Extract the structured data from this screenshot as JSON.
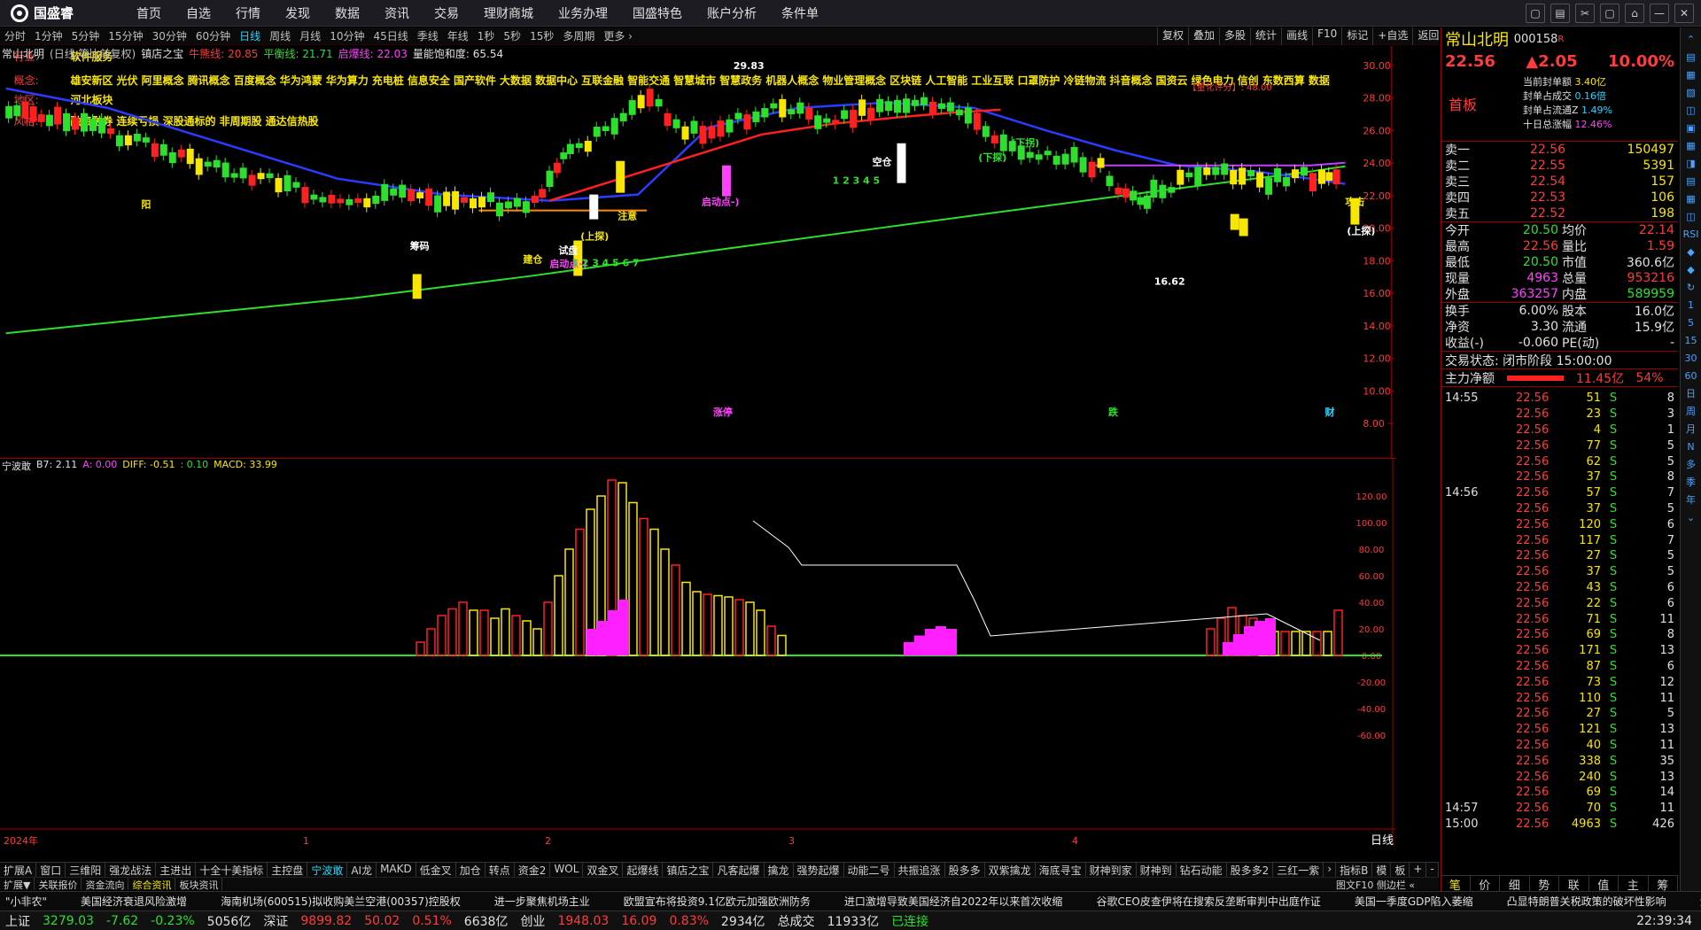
{
  "app": {
    "logo_text": "国盛睿"
  },
  "menu": [
    "首页",
    "自选",
    "行情",
    "发现",
    "数据",
    "资讯",
    "交易",
    "理财商城",
    "业务办理",
    "国盛特色",
    "账户分析",
    "条件单"
  ],
  "window_buttons": [
    "▢",
    "▤",
    "✂",
    "▢",
    "⌂",
    "—",
    "✕"
  ],
  "periods": [
    "分时",
    "1分钟",
    "5分钟",
    "15分钟",
    "30分钟",
    "60分钟",
    "日线",
    "周线",
    "月线",
    "10分钟",
    "45日线",
    "季线",
    "年线",
    "1秒",
    "5秒",
    "15秒",
    "多周期",
    "更多 ›"
  ],
  "active_period": "日线",
  "tools": [
    "复权",
    "叠加",
    "多股",
    "统计",
    "画线",
    "F10",
    "标记",
    "+自选",
    "返回"
  ],
  "info": {
    "name": "常山北明",
    "mode": "(日线,等比前复权)",
    "indicator": "镇店之宝",
    "niu": "牛熊线: 20.85",
    "ping": "平衡线: 21.71",
    "qi": "启爆线: 22.03",
    "zhan": "量能饱和度: 65.54"
  },
  "labels": {
    "hangye_k": "行业:",
    "hangye_v": "软件服务",
    "gainian_k": "概念:",
    "gainian_v": "雄安新区 光伏 阿里概念 腾讯概念 百度概念 华为鸿蒙 华为算力 充电桩 信息安全 国产软件 大数据 数据中心 互联金融 智能交通 智慧城市 智慧政务 机器人概念 物业管理概念 区块链 人工智能 工业互联 口罩防护 冷链物流 抖音概念 国资云 绿色电力 信创 东数西算 数据",
    "diqu_k": "地区:",
    "diqu_v": "河北板块",
    "fengge_k": "风格:",
    "fengge_v": "融资融券 连续亏损 深股通标的 非周期股 通达信热股",
    "score": "【量化评分】: 48.00"
  },
  "price_axis": [
    "30.00",
    "28.00",
    "26.00",
    "24.00",
    "22.00",
    "20.00",
    "18.00",
    "16.00",
    "14.00",
    "12.00",
    "10.00",
    "8.00"
  ],
  "annotations": {
    "hi": "29.83",
    "lo": "16.62",
    "a1": "启动点-)",
    "a2": "启动点-)",
    "a3": "(上探)",
    "a4": "(下探)",
    "a5": "(上探)",
    "a6": "试盘",
    "a7": "建仓",
    "a8": "攻击",
    "a9": "空仓",
    "a10": "(下拐)",
    "a11": "筹码",
    "a12": "涨停",
    "a13": "跌",
    "a14": "财",
    "a15": "阳",
    "a16": "注意",
    "a17": "1 2 3 4 5 6 7",
    "a18": "1 2 3 4 5"
  },
  "sub_info": {
    "name": "宁波敢",
    "b7": "B7: 2.11",
    "a": "A: 0.00",
    "diff": "DIFF: -0.51",
    "dea": ": 0.10",
    "macd": "MACD: 33.99"
  },
  "sub_axis": [
    "120.00",
    "100.00",
    "80.00",
    "60.00",
    "40.00",
    "20.00",
    "0.00",
    "-20.00",
    "-40.00",
    "-60.00"
  ],
  "date_labels": [
    "2024年",
    "1",
    "2",
    "3",
    "4"
  ],
  "date_right": "日线",
  "quote": {
    "name": "常山北明",
    "code": "000158",
    "flag": "R",
    "price": "22.56",
    "change": "▲2.05",
    "pct": "10.00%",
    "board": "首板",
    "seal": [
      [
        "当前封单额",
        "3.40亿"
      ],
      [
        "封单占成交",
        "0.16倍"
      ],
      [
        "封单占流通Z",
        "1.49%"
      ],
      [
        "十日总涨幅",
        "12.46%"
      ]
    ],
    "asks": [
      [
        "卖一",
        "22.56",
        "150497"
      ],
      [
        "卖二",
        "22.55",
        "5391"
      ],
      [
        "卖三",
        "22.54",
        "157"
      ],
      [
        "卖四",
        "22.53",
        "106"
      ],
      [
        "卖五",
        "22.52",
        "198"
      ]
    ],
    "stats": [
      [
        "今开",
        "20.50",
        "均价",
        "22.14"
      ],
      [
        "最高",
        "22.56",
        "量比",
        "1.59"
      ],
      [
        "最低",
        "20.50",
        "市值",
        "360.6亿"
      ],
      [
        "现量",
        "4963",
        "总量",
        "953216"
      ],
      [
        "外盘",
        "363257",
        "内盘",
        "589959"
      ]
    ],
    "stats2": [
      [
        "换手",
        "6.00%",
        "股本",
        "16.0亿"
      ],
      [
        "净资",
        "3.30",
        "流通",
        "15.9亿"
      ],
      [
        "收益(-)",
        "-0.060",
        "PE(动)",
        "-"
      ]
    ],
    "trade_state": "交易状态: 闭市阶段 15:00:00",
    "main_flow_label": "主力净额",
    "main_flow": "11.45亿",
    "main_flow_pct": "54%"
  },
  "ticks": [
    [
      "14:55",
      "22.56",
      "51",
      "S",
      "8"
    ],
    [
      "",
      "22.56",
      "23",
      "S",
      "3"
    ],
    [
      "",
      "22.56",
      "4",
      "S",
      "1"
    ],
    [
      "",
      "22.56",
      "77",
      "S",
      "5"
    ],
    [
      "",
      "22.56",
      "62",
      "S",
      "5"
    ],
    [
      "",
      "22.56",
      "37",
      "S",
      "8"
    ],
    [
      "14:56",
      "22.56",
      "57",
      "S",
      "7"
    ],
    [
      "",
      "22.56",
      "37",
      "S",
      "5"
    ],
    [
      "",
      "22.56",
      "120",
      "S",
      "6"
    ],
    [
      "",
      "22.56",
      "117",
      "S",
      "7"
    ],
    [
      "",
      "22.56",
      "27",
      "S",
      "5"
    ],
    [
      "",
      "22.56",
      "37",
      "S",
      "5"
    ],
    [
      "",
      "22.56",
      "43",
      "S",
      "6"
    ],
    [
      "",
      "22.56",
      "22",
      "S",
      "6"
    ],
    [
      "",
      "22.56",
      "71",
      "S",
      "11"
    ],
    [
      "",
      "22.56",
      "69",
      "S",
      "8"
    ],
    [
      "",
      "22.56",
      "171",
      "S",
      "13"
    ],
    [
      "",
      "22.56",
      "87",
      "S",
      "6"
    ],
    [
      "",
      "22.56",
      "73",
      "S",
      "12"
    ],
    [
      "",
      "22.56",
      "110",
      "S",
      "11"
    ],
    [
      "",
      "22.56",
      "27",
      "S",
      "5"
    ],
    [
      "",
      "22.56",
      "121",
      "S",
      "13"
    ],
    [
      "",
      "22.56",
      "40",
      "S",
      "11"
    ],
    [
      "",
      "22.56",
      "338",
      "S",
      "35"
    ],
    [
      "",
      "22.56",
      "240",
      "S",
      "13"
    ],
    [
      "",
      "22.56",
      "69",
      "S",
      "14"
    ],
    [
      "14:57",
      "22.56",
      "70",
      "S",
      "11"
    ],
    [
      "15:00",
      "22.56",
      "4963",
      "S",
      "426"
    ]
  ],
  "right_side": [
    "⌃",
    "▤",
    "▦",
    "▧",
    "◫",
    "▣",
    "▦",
    "◨",
    "▤",
    "▦",
    "◫",
    "RSI",
    "◆",
    "◆",
    "↻",
    "1",
    "5",
    "15",
    "30",
    "60",
    "日",
    "周",
    "月",
    "N",
    "多",
    "季",
    "年",
    "⌄"
  ],
  "tabs": [
    "扩展A",
    "窗口",
    "三维阳",
    "强龙战法",
    "主进出",
    "十全十美指标",
    "主控盘",
    "宁波敢",
    "AI龙",
    "MAKD",
    "低金叉",
    "加仓",
    "转点",
    "资金2",
    "WOL",
    "双金叉",
    "起爆线",
    "镇店之宝",
    "凡客起爆",
    "擒龙",
    "强势起爆",
    "动能二号",
    "共振追涨",
    "股多多",
    "双紫擒龙",
    "海底寻宝",
    "财神到家",
    "财神到",
    "钻石动能",
    "股多多2",
    "三红一紫",
    "›",
    "指标B",
    "模",
    "板",
    "+",
    "-"
  ],
  "active_tab": "宁波敢",
  "tabs2": [
    "扩展▼",
    "关联报价",
    "资金流向",
    "综合资讯",
    "板块资讯"
  ],
  "active_tab2": "综合资讯",
  "tabs2_right": "图文F10 侧边栏 «",
  "bottom_tabs": [
    "笔",
    "价",
    "细",
    "势",
    "联",
    "值",
    "主",
    "筹"
  ],
  "news": [
    "\"小非农\"",
    "美国经济衰退风险激增",
    "海南机场(600515)拟收购美兰空港(00357)控股权",
    "进一步聚焦机场主业",
    "欧盟宣布将投资9.1亿欧元加强欧洲防务",
    "进口激增导致美国经济自2022年以来首次收缩",
    "谷歌CEO皮查伊将在搜索反垄断审判中出庭作证",
    "美国一季度GDP陷入萎缩",
    "凸显特朗普关税政策的破坏性影响",
    "海南机场"
  ],
  "status": [
    {
      "k": "上证",
      "v": "3279.03",
      "c": "-7.62",
      "p": "-0.23%",
      "a": "5056亿"
    },
    {
      "k": "深证",
      "v": "9899.82",
      "c": "50.02",
      "p": "0.51%",
      "a": "6638亿"
    },
    {
      "k": "创业",
      "v": "1948.03",
      "c": "16.09",
      "p": "0.83%",
      "a": "2934亿"
    }
  ],
  "status_total": "总成交",
  "status_total_v": "11933亿",
  "status_conn": "已连接",
  "clock": "22:39:34",
  "colors": {
    "up": "#ff3b3b",
    "down": "#2de02d",
    "blue": "#2a3cff",
    "yellow": "#f7e600"
  }
}
